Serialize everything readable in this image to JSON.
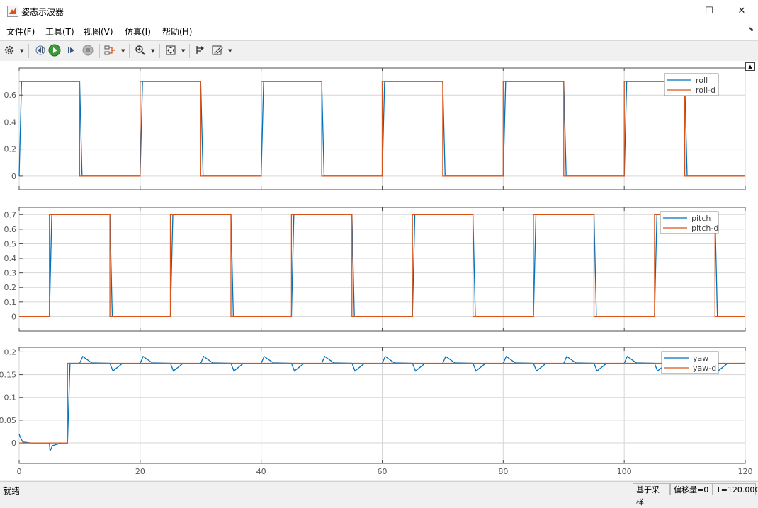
{
  "window": {
    "title": "姿态示波器",
    "minimize": "—",
    "maximize": "☐",
    "close": "✕"
  },
  "menu": {
    "items": [
      "文件(F)",
      "工具(T)",
      "视图(V)",
      "仿真(I)",
      "帮助(H)"
    ]
  },
  "toolbar": {
    "icons": [
      "gear-icon",
      "step-back-icon",
      "run-icon",
      "step-forward-icon",
      "stop-icon",
      "signal-highlight-icon",
      "zoom-icon",
      "fit-to-view-icon",
      "cursor-measure-icon",
      "style-icon"
    ]
  },
  "colors": {
    "series1": "#0072BD",
    "series2": "#D95319",
    "grid": "#d6d6d6",
    "axes": "#4d4d4d"
  },
  "charts": [
    {
      "name": "roll-axes",
      "legend": [
        "roll",
        "roll-d"
      ],
      "ylim": [
        -0.1,
        0.8
      ],
      "yticks": [
        0,
        0.2,
        0.4,
        0.6
      ],
      "ytick_labels": [
        "0",
        "0.2",
        "0.4",
        "0.6"
      ]
    },
    {
      "name": "pitch-axes",
      "legend": [
        "pitch",
        "pitch-d"
      ],
      "ylim": [
        -0.1,
        0.75
      ],
      "yticks": [
        0,
        0.1,
        0.2,
        0.3,
        0.4,
        0.5,
        0.6,
        0.7
      ],
      "ytick_labels": [
        "0",
        "0.1",
        "0.2",
        "0.3",
        "0.4",
        "0.5",
        "0.6",
        "0.7"
      ]
    },
    {
      "name": "yaw-axes",
      "legend": [
        "yaw",
        "yaw-d"
      ],
      "ylim": [
        -0.045,
        0.21
      ],
      "yticks": [
        0,
        0.05,
        0.1,
        0.15,
        0.2
      ],
      "ytick_labels": [
        "0",
        "0.05",
        "0.1",
        "0.15",
        "0.2"
      ]
    }
  ],
  "chart_data": [
    {
      "type": "line",
      "title": "",
      "xlim": [
        0,
        120
      ],
      "ylim": [
        -0.1,
        0.8
      ],
      "grid": true,
      "legend_position": "top-right",
      "series": [
        {
          "name": "roll",
          "x": [
            0,
            0.4,
            10,
            10.4,
            20,
            20.4,
            30,
            30.4,
            40,
            40.4,
            50,
            50.4,
            60,
            60.4,
            70,
            70.4,
            80,
            80.4,
            90,
            90.4,
            100,
            100.4,
            110,
            110.4,
            120
          ],
          "y": [
            0,
            0.7,
            0.7,
            0,
            0,
            0.7,
            0.7,
            0,
            0,
            0.7,
            0.7,
            0,
            0,
            0.7,
            0.7,
            0,
            0,
            0.7,
            0.7,
            0,
            0,
            0.7,
            0.7,
            0,
            0
          ]
        },
        {
          "name": "roll-d",
          "x": [
            0,
            0,
            10,
            10,
            20,
            20,
            30,
            30,
            40,
            40,
            50,
            50,
            60,
            60,
            70,
            70,
            80,
            80,
            90,
            90,
            100,
            100,
            110,
            110,
            120
          ],
          "y": [
            0.7,
            0.7,
            0.7,
            0,
            0,
            0.7,
            0.7,
            0,
            0,
            0.7,
            0.7,
            0,
            0,
            0.7,
            0.7,
            0,
            0,
            0.7,
            0.7,
            0,
            0,
            0.7,
            0.7,
            0,
            0
          ]
        }
      ]
    },
    {
      "type": "line",
      "title": "",
      "xlim": [
        0,
        120
      ],
      "ylim": [
        -0.1,
        0.75
      ],
      "grid": true,
      "legend_position": "top-right",
      "series": [
        {
          "name": "pitch",
          "x": [
            0,
            5,
            5.4,
            15,
            15.4,
            25,
            25.4,
            35,
            35.4,
            45,
            45.4,
            55,
            55.4,
            65,
            65.4,
            75,
            75.4,
            85,
            85.4,
            95,
            95.4,
            105,
            105.4,
            115,
            115.4,
            120
          ],
          "y": [
            0,
            0,
            0.7,
            0.7,
            0,
            0,
            0.7,
            0.7,
            0,
            0,
            0.7,
            0.7,
            0,
            0,
            0.7,
            0.7,
            0,
            0,
            0.7,
            0.7,
            0,
            0,
            0.7,
            0.7,
            0,
            0
          ]
        },
        {
          "name": "pitch-d",
          "x": [
            0,
            5,
            5,
            15,
            15,
            25,
            25,
            35,
            35,
            45,
            45,
            55,
            55,
            65,
            65,
            75,
            75,
            85,
            85,
            95,
            95,
            105,
            105,
            115,
            115,
            120
          ],
          "y": [
            0,
            0,
            0.7,
            0.7,
            0,
            0,
            0.7,
            0.7,
            0,
            0,
            0.7,
            0.7,
            0,
            0,
            0.7,
            0.7,
            0,
            0,
            0.7,
            0.7,
            0,
            0,
            0.7,
            0.7,
            0,
            0
          ]
        }
      ]
    },
    {
      "type": "line",
      "title": "",
      "xlim": [
        0,
        120
      ],
      "ylim": [
        -0.045,
        0.21
      ],
      "grid": true,
      "legend_position": "top-right",
      "series": [
        {
          "name": "yaw",
          "x": [
            0,
            0.1,
            0.6,
            2,
            5,
            5.1,
            5.5,
            7,
            8,
            8.4,
            10,
            10.5,
            12,
            15,
            15.5,
            17,
            20,
            20.5,
            22,
            25,
            25.5,
            27,
            30,
            30.5,
            32,
            35,
            35.5,
            37,
            40,
            40.5,
            42,
            45,
            45.5,
            47,
            50,
            50.5,
            52,
            55,
            55.5,
            57,
            60,
            60.5,
            62,
            65,
            65.5,
            67,
            70,
            70.5,
            72,
            75,
            75.5,
            77,
            80,
            80.5,
            82,
            85,
            85.5,
            87,
            90,
            90.5,
            92,
            95,
            95.5,
            97,
            100,
            100.5,
            102,
            105,
            105.5,
            107,
            110,
            110.5,
            112,
            115,
            115.5,
            117,
            120
          ],
          "y": [
            0.02,
            0.015,
            0.002,
            0,
            0,
            -0.018,
            -0.006,
            0,
            0,
            0.175,
            0.175,
            0.19,
            0.176,
            0.175,
            0.158,
            0.174,
            0.175,
            0.19,
            0.176,
            0.175,
            0.158,
            0.174,
            0.175,
            0.19,
            0.176,
            0.175,
            0.158,
            0.174,
            0.175,
            0.19,
            0.176,
            0.175,
            0.158,
            0.174,
            0.175,
            0.19,
            0.176,
            0.175,
            0.158,
            0.174,
            0.175,
            0.19,
            0.176,
            0.175,
            0.158,
            0.174,
            0.175,
            0.19,
            0.176,
            0.175,
            0.158,
            0.174,
            0.175,
            0.19,
            0.176,
            0.175,
            0.158,
            0.174,
            0.175,
            0.19,
            0.176,
            0.175,
            0.158,
            0.174,
            0.175,
            0.19,
            0.176,
            0.175,
            0.158,
            0.174,
            0.175,
            0.19,
            0.176,
            0.175,
            0.158,
            0.174,
            0.175
          ]
        },
        {
          "name": "yaw-d",
          "x": [
            0,
            8,
            8,
            120
          ],
          "y": [
            0,
            0,
            0.175,
            0.175
          ]
        }
      ]
    }
  ],
  "xaxis": {
    "ticks": [
      0,
      20,
      40,
      60,
      80,
      100,
      120
    ],
    "tick_labels": [
      "0",
      "20",
      "40",
      "60",
      "80",
      "100",
      "120"
    ]
  },
  "status": {
    "left": "就绪",
    "sample_based": "基于采样",
    "offset": "偏移量=0",
    "time": "T=120.000"
  }
}
